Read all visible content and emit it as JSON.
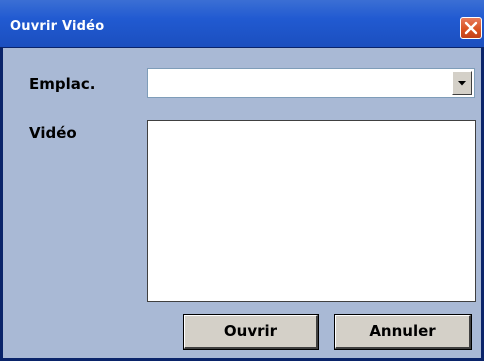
{
  "window": {
    "title": "Ouvrir Vidéo",
    "close_icon": "close-icon",
    "accent_color": "#215ad1",
    "background_color": "#a9b9d5"
  },
  "form": {
    "location_label": "Emplac.",
    "location_value": "",
    "location_dropdown_icon": "chevron-down-icon",
    "video_label": "Vidéo",
    "video_items": []
  },
  "buttons": {
    "open_label": "Ouvrir",
    "cancel_label": "Annuler"
  }
}
